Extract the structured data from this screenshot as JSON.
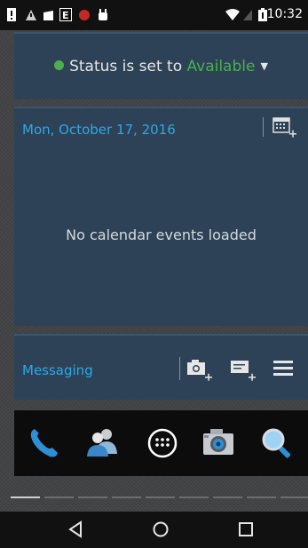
{
  "status_bar": {
    "time": "10:32",
    "icons": [
      "notification-icon",
      "warning-icon",
      "shopping-bag-icon",
      "e-app-icon",
      "red-app-icon",
      "android-icon",
      "wifi-icon",
      "no-signal-icon",
      "battery-icon"
    ]
  },
  "status": {
    "prefix": "Status is set to",
    "value": "Available",
    "dot_color": "#4caf50"
  },
  "calendar": {
    "date": "Mon, October 17, 2016",
    "empty_message": "No calendar events loaded"
  },
  "messaging": {
    "label": "Messaging",
    "actions": [
      "camera-add-icon",
      "compose-message-icon",
      "menu-icon"
    ]
  },
  "dock": {
    "apps": [
      "phone-icon",
      "contacts-icon",
      "app-drawer-icon",
      "camera-icon",
      "search-icon"
    ]
  },
  "nav": {
    "buttons": [
      "back-icon",
      "home-icon",
      "recents-icon"
    ]
  },
  "colors": {
    "accent": "#2ea8e6",
    "panel": "#2d4257",
    "available": "#4caf50"
  }
}
